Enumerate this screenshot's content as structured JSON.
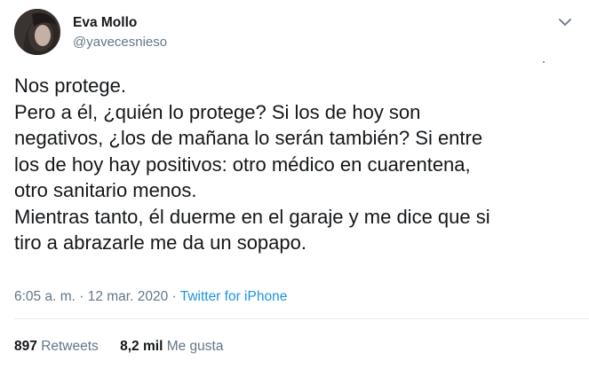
{
  "user": {
    "name": "Eva Mollo",
    "handle": "@yavecesnieso"
  },
  "tweet": {
    "text": "Nos protege.\nPero a él, ¿quién lo protege? Si los de hoy son\nnegativos, ¿los de mañana lo serán también? Si entre\nlos de hoy hay positivos: otro médico en cuarentena,\notro sanitario menos.\nMientras tanto, él duerme en el garaje y me dice que si\ntiro a abrazarle me da un sopapo.",
    "time": "6:05 a. m.",
    "separator": " · ",
    "date": "12 mar. 2020",
    "source": "Twitter for iPhone"
  },
  "stats": {
    "retweets_count": "897",
    "retweets_label": "Retweets",
    "likes_count": "8,2 mil",
    "likes_label": "Me gusta"
  },
  "icons": {
    "more": "chevron-down-icon"
  },
  "colors": {
    "text": "#14171a",
    "secondary": "#657786",
    "link": "#1b95e0",
    "divider": "#e6ecf0"
  }
}
